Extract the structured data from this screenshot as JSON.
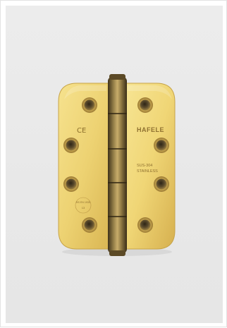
{
  "image": {
    "subject": "hinge",
    "markings": {
      "ce_mark": "CE",
      "brand": "HAFELE",
      "material_line1": "SUS-304",
      "material_line2": "STAINLESS",
      "circular_stamp_top": "BS EN 1935",
      "circular_stamp_bottom": "13"
    },
    "colors": {
      "background": "#e9e9e9",
      "brass_light": "#f3dc82",
      "brass_mid": "#e2c05a",
      "brass_dark": "#b8923a",
      "knuckle": "#6e5a2f",
      "screw_hole": "#4b3f2a"
    }
  }
}
